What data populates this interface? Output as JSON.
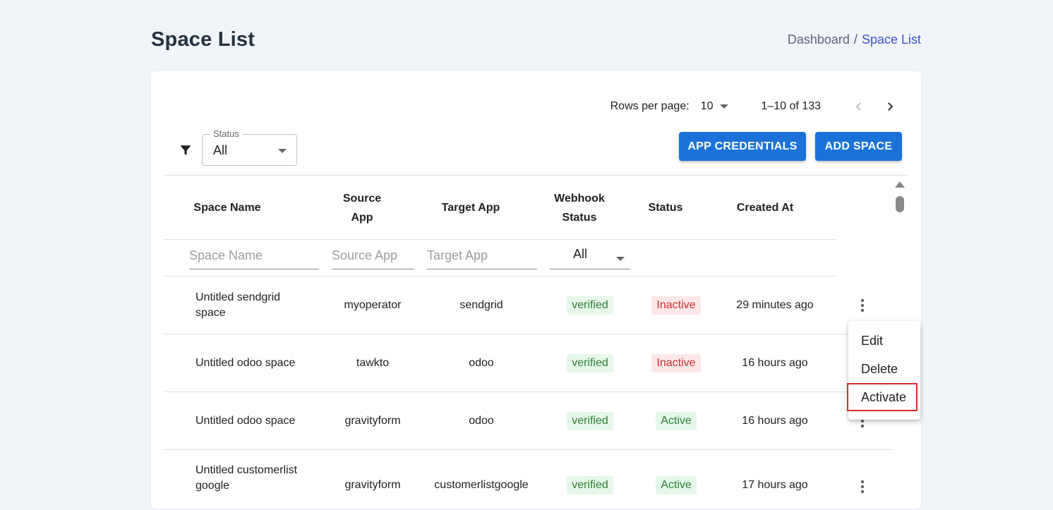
{
  "header": {
    "title": "Space List",
    "breadcrumb": {
      "home": "Dashboard",
      "separator": "/",
      "current": "Space List"
    }
  },
  "pagination": {
    "rows_per_page_label": "Rows per page:",
    "rows_per_page_value": "10",
    "range_text": "1–10 of 133"
  },
  "filters": {
    "status_label": "Status",
    "status_value": "All"
  },
  "actions": {
    "app_credentials": "APP CREDENTIALS",
    "add_space": "ADD SPACE"
  },
  "table": {
    "headers": {
      "space_name": "Space Name",
      "source_app_line1": "Source",
      "source_app_line2": "App",
      "target_app": "Target App",
      "webhook_line1": "Webhook",
      "webhook_line2": "Status",
      "status": "Status",
      "created_at": "Created At"
    },
    "column_filters": {
      "space_name_placeholder": "Space Name",
      "source_app_placeholder": "Source App",
      "target_app_placeholder": "Target App",
      "webhook_value": "All"
    },
    "rows": [
      {
        "name": "Untitled sendgrid space",
        "source": "myoperator",
        "target": "sendgrid",
        "webhook": "verified",
        "status": "Inactive",
        "created": "29 minutes ago"
      },
      {
        "name": "Untitled odoo space",
        "source": "tawkto",
        "target": "odoo",
        "webhook": "verified",
        "status": "Inactive",
        "created": "16 hours ago"
      },
      {
        "name": "Untitled odoo space",
        "source": "gravityform",
        "target": "odoo",
        "webhook": "verified",
        "status": "Active",
        "created": "16 hours ago"
      },
      {
        "name": "Untitled customerlistgoogle",
        "source": "gravityform",
        "target": "customerlistgoogle",
        "webhook": "verified",
        "status": "Active",
        "created": "17 hours ago"
      }
    ]
  },
  "menu": {
    "edit": "Edit",
    "delete": "Delete",
    "activate": "Activate"
  },
  "colors": {
    "primary": "#1b72d8",
    "active_bg": "#e6f8ea",
    "active_text": "#2e7d32",
    "inactive_bg": "#fde7e9",
    "inactive_text": "#d32f2f",
    "highlight_border": "#d32f2f"
  }
}
